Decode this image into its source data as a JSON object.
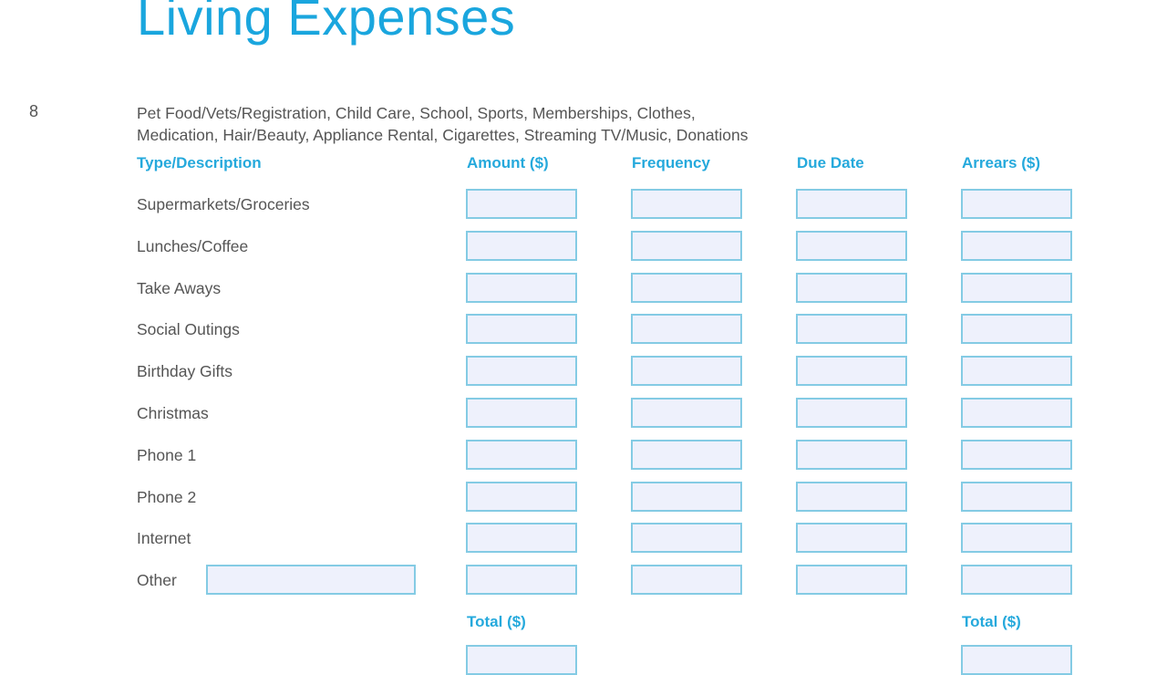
{
  "page": {
    "title": "Living Expenses",
    "section_number": "8",
    "description_line1": "Pet Food/Vets/Registration, Child Care, School, Sports, Memberships, Clothes,",
    "description_line2": "Medication, Hair/Beauty, Appliance Rental, Cigarettes, Streaming TV/Music, Donations"
  },
  "table": {
    "headers": [
      "Type/Description",
      "Amount ($)",
      "Frequency",
      "Due Date",
      "Arrears ($)"
    ],
    "rows": [
      {
        "label": "Supermarkets/Groceries",
        "amount": "",
        "frequency": "",
        "due_date": "",
        "arrears": ""
      },
      {
        "label": "Lunches/Coffee",
        "amount": "",
        "frequency": "",
        "due_date": "",
        "arrears": ""
      },
      {
        "label": "Take Aways",
        "amount": "",
        "frequency": "",
        "due_date": "",
        "arrears": ""
      },
      {
        "label": "Social Outings",
        "amount": "",
        "frequency": "",
        "due_date": "",
        "arrears": ""
      },
      {
        "label": "Birthday Gifts",
        "amount": "",
        "frequency": "",
        "due_date": "",
        "arrears": ""
      },
      {
        "label": "Christmas",
        "amount": "",
        "frequency": "",
        "due_date": "",
        "arrears": ""
      },
      {
        "label": "Phone 1",
        "amount": "",
        "frequency": "",
        "due_date": "",
        "arrears": ""
      },
      {
        "label": "Phone 2",
        "amount": "",
        "frequency": "",
        "due_date": "",
        "arrears": ""
      },
      {
        "label": "Internet",
        "amount": "",
        "frequency": "",
        "due_date": "",
        "arrears": ""
      },
      {
        "label": "Other",
        "other_description": "",
        "amount": "",
        "frequency": "",
        "due_date": "",
        "arrears": ""
      }
    ],
    "totals": {
      "amount_label": "Total ($)",
      "amount_value": "",
      "arrears_label": "Total ($)",
      "arrears_value": ""
    }
  }
}
